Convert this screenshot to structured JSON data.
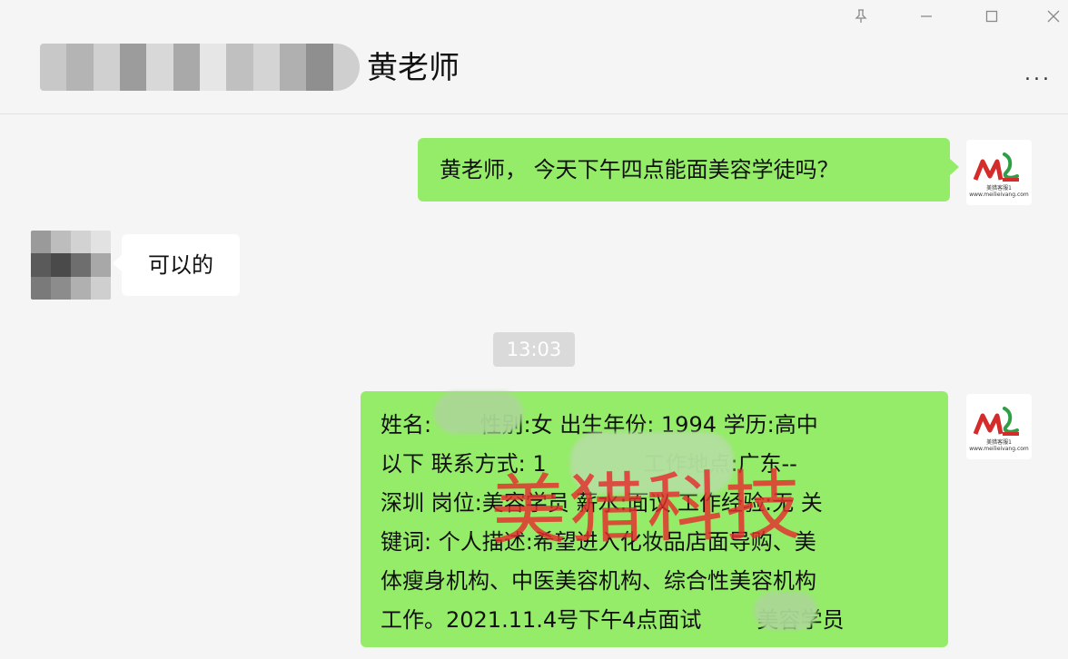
{
  "window": {
    "controls": [
      "pin-icon",
      "minimize-icon",
      "maximize-icon",
      "close-icon"
    ]
  },
  "header": {
    "title": "黄老师",
    "more_label": "..."
  },
  "messages": [
    {
      "side": "right",
      "text": "黄老师， 今天下午四点能面美容学徒吗？"
    },
    {
      "side": "left",
      "text": "可以的"
    },
    {
      "side": "right",
      "text": "姓名:（已打码） 性别:女 出生年份: 1994 学历:高中以下 联系方式: 1（已打码） 工作地点:广东--深圳 岗位:美容学员 薪水:面议 工作经验:无 关键词: 个人描述:希望进入化妆品店面导购、美体瘦身机构、中医美容机构、综合性美容机构工作。2021.11.4号下午4点面试（已打码）美容学员",
      "lines": [
        "姓名:       性别:女 出生年份: 1994 学历:高中",
        "以下 联系方式: 1              工作地点:广东--",
        "深圳 岗位:美容学员 薪水:面议 工作经验:无 关",
        "键词: 个人描述:希望进入化妆品店面导购、美",
        "体瘦身机构、中医美容机构、综合性美容机构",
        "工作。2021.11.4号下午4点面试        美容学员"
      ]
    }
  ],
  "timestamp": "13:03",
  "avatar_logo": {
    "letters": "ML",
    "caption_line1": "美猎客服1",
    "caption_line2": "www.meilieivang.com"
  },
  "watermark": "美猎科技",
  "colors": {
    "background": "#f5f5f5",
    "sent_bubble": "#95ec69",
    "received_bubble": "#ffffff",
    "timestamp_bg": "#dadada",
    "watermark": "#e42d2d",
    "logo_red": "#d42b2b",
    "logo_green": "#2f9e44"
  }
}
